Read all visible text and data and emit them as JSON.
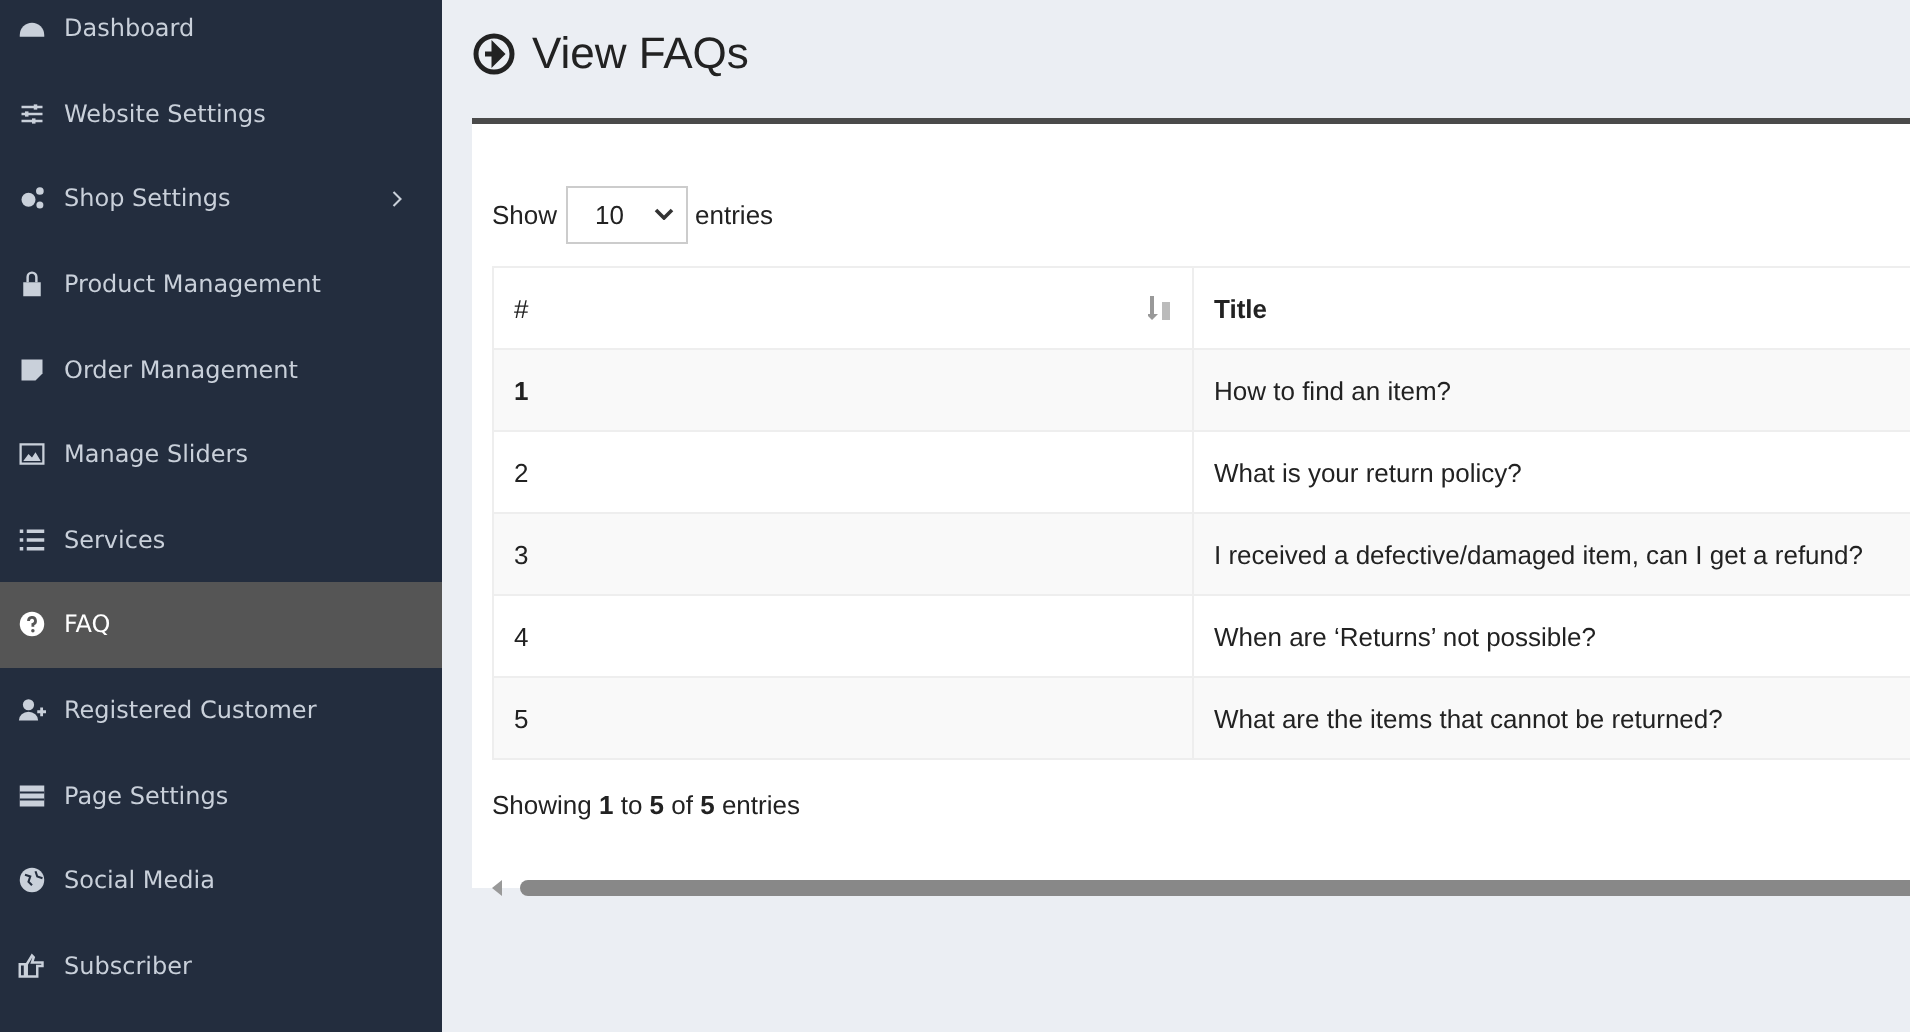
{
  "sidebar": {
    "items": [
      {
        "label": "Dashboard",
        "selected": false,
        "submenu": false
      },
      {
        "label": "Website Settings",
        "selected": false,
        "submenu": false
      },
      {
        "label": "Shop Settings",
        "selected": false,
        "submenu": true
      },
      {
        "label": "Product Management",
        "selected": false,
        "submenu": false
      },
      {
        "label": "Order Management",
        "selected": false,
        "submenu": false
      },
      {
        "label": "Manage Sliders",
        "selected": false,
        "submenu": false
      },
      {
        "label": "Services",
        "selected": false,
        "submenu": false
      },
      {
        "label": "FAQ",
        "selected": true,
        "submenu": false
      },
      {
        "label": "Registered Customer",
        "selected": false,
        "submenu": false
      },
      {
        "label": "Page Settings",
        "selected": false,
        "submenu": false
      },
      {
        "label": "Social Media",
        "selected": false,
        "submenu": false
      },
      {
        "label": "Subscriber",
        "selected": false,
        "submenu": false
      }
    ]
  },
  "page_title": "View FAQs",
  "length_menu": {
    "before": "Show",
    "value": "10",
    "after": "entries"
  },
  "table": {
    "columns": [
      "#",
      "Title"
    ],
    "rows": [
      {
        "cells": [
          "1",
          "How to find an item?"
        ],
        "bold": true
      },
      {
        "cells": [
          "2",
          "What is your return policy?"
        ],
        "bold": false
      },
      {
        "cells": [
          "3",
          "I received a defective/damaged item, can I get a refund?"
        ],
        "bold": false
      },
      {
        "cells": [
          "4",
          "When are ‘Returns’ not possible?"
        ],
        "bold": false
      },
      {
        "cells": [
          "5",
          "What are the items that cannot be returned?"
        ],
        "bold": false
      }
    ]
  },
  "info": "Showing **1** to **5** of **5** entries"
}
